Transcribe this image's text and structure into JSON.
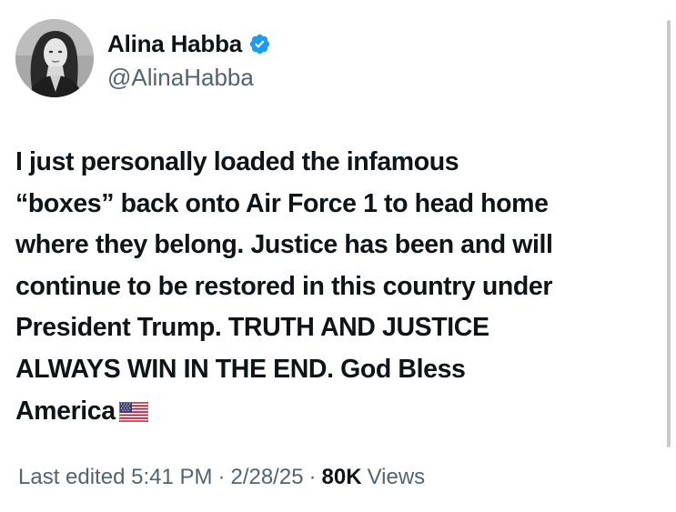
{
  "author": {
    "display_name": "Alina Habba",
    "handle": "@AlinaHabba",
    "verified": true
  },
  "post": {
    "text_lines": [
      "I just personally loaded the infamous",
      "“boxes” back onto Air Force 1 to head home",
      "where they belong. Justice has been and will",
      "continue to be restored in this country under",
      "President Trump.  TRUTH AND JUSTICE",
      "ALWAYS WIN IN THE END. God Bless",
      "America"
    ],
    "emoji": "us-flag-emoji"
  },
  "meta": {
    "edited_label": "Last edited 5:41 PM",
    "separator": "·",
    "date": "2/28/25",
    "views_count": "80K",
    "views_label": "Views"
  },
  "colors": {
    "text": "#0f1419",
    "secondary": "#536471",
    "verified_blue": "#1d9bf0",
    "background": "#ffffff"
  }
}
